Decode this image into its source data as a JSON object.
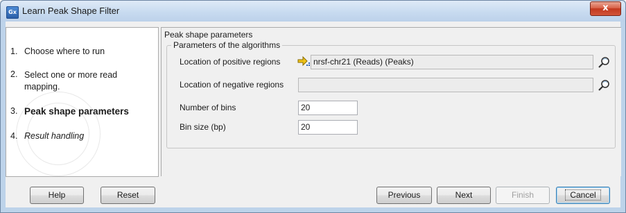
{
  "window": {
    "title": "Learn Peak Shape Filter",
    "app_icon_text": "Gx",
    "close_glyph": "x"
  },
  "steps": [
    {
      "number": "1.",
      "label": "Choose where to run",
      "style": "normal"
    },
    {
      "number": "2.",
      "label": "Select one or more read mapping.",
      "style": "normal"
    },
    {
      "number": "3.",
      "label": "Peak shape parameters",
      "style": "bold"
    },
    {
      "number": "4.",
      "label": "Result handling",
      "style": "italic"
    }
  ],
  "panel": {
    "section_title": "Peak shape parameters",
    "group_title": "Parameters of the algorithms",
    "positive_label": "Location of positive regions",
    "positive_value": "nrsf-chr21 (Reads) (Peaks)",
    "negative_label": "Location of negative regions",
    "negative_value": "",
    "bins_label": "Number of bins",
    "bins_value": "20",
    "binsize_label": "Bin size (bp)",
    "binsize_value": "20"
  },
  "buttons": {
    "help": "Help",
    "reset": "Reset",
    "previous": "Previous",
    "next": "Next",
    "finish": "Finish",
    "cancel": "Cancel"
  },
  "colors": {
    "titlebar": "#c8dbf0",
    "close": "#c2391f",
    "default_button_border": "#3c7fb1"
  }
}
